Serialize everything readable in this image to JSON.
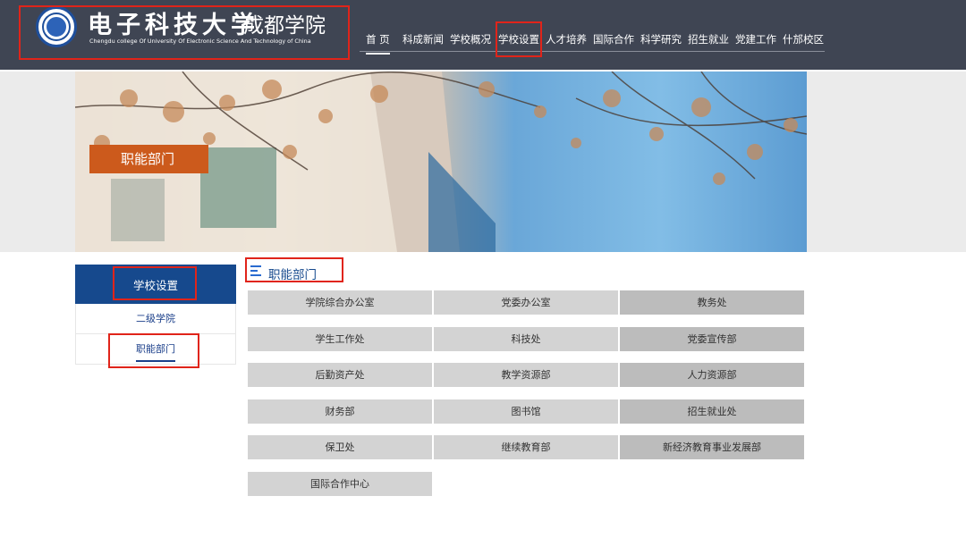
{
  "header": {
    "logo_cn": "电子科技大学",
    "logo_cn2": "成都学院",
    "logo_en": "Chengdu college Of University Of Electronic Science And Technology  of  China",
    "nav": [
      "首 页",
      "科成新闻",
      "学校概况",
      "学校设置",
      "人才培养",
      "国际合作",
      "科学研究",
      "招生就业",
      "党建工作",
      "什邡校区"
    ],
    "active_nav": "首 页"
  },
  "banner": {
    "label": "职能部门"
  },
  "sidebar": {
    "title": "学校设置",
    "items": [
      {
        "label": "二级学院"
      },
      {
        "label": "职能部门"
      }
    ]
  },
  "section": {
    "title": "职能部门"
  },
  "departments": [
    "学院综合办公室",
    "党委办公室",
    "教务处",
    "学生工作处",
    "科技处",
    "党委宣传部",
    "后勤资产处",
    "教学资源部",
    "人力资源部",
    "财务部",
    "图书馆",
    "招生就业处",
    "保卫处",
    "继续教育部",
    "新经济教育事业发展部",
    "国际合作中心"
  ],
  "colors": {
    "header": "#3f4553",
    "accent_blue": "#16498d",
    "highlight_red": "#e0241a",
    "banner_label": "#cc5a1c"
  }
}
